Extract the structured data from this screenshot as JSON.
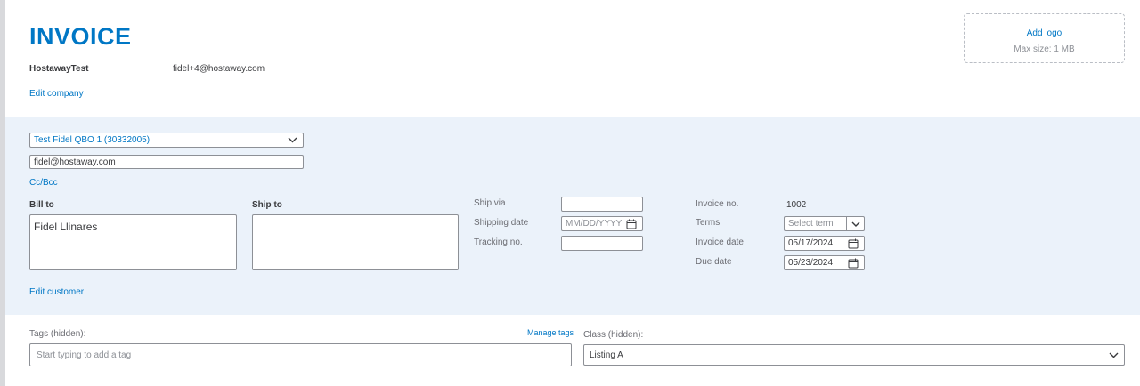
{
  "header": {
    "title": "INVOICE",
    "company_name": "HostawayTest",
    "company_email": "fidel+4@hostaway.com",
    "edit_company": "Edit company",
    "logo": {
      "add_label": "Add logo",
      "max_size": "Max size: 1 MB"
    }
  },
  "customer": {
    "selected": "Test Fidel QBO 1 (30332005)",
    "email": "fidel@hostaway.com",
    "cc_bcc": "Cc/Bcc",
    "bill_to_label": "Bill to",
    "bill_to_value": "Fidel Llinares",
    "ship_to_label": "Ship to",
    "ship_to_value": "",
    "edit_customer": "Edit customer"
  },
  "shipping": {
    "ship_via_label": "Ship via",
    "ship_via_value": "",
    "shipping_date_label": "Shipping date",
    "shipping_date_placeholder": "MM/DD/YYYY",
    "tracking_label": "Tracking no.",
    "tracking_value": ""
  },
  "invoice": {
    "number_label": "Invoice no.",
    "number_value": "1002",
    "terms_label": "Terms",
    "terms_placeholder": "Select term",
    "invoice_date_label": "Invoice date",
    "invoice_date_value": "05/17/2024",
    "due_date_label": "Due date",
    "due_date_value": "05/23/2024"
  },
  "tags": {
    "label": "Tags (hidden):",
    "manage": "Manage tags",
    "placeholder": "Start typing to add a tag"
  },
  "class_field": {
    "label": "Class (hidden):",
    "value": "Listing A"
  },
  "colors": {
    "accent": "#0077c5",
    "band": "#ebf2fa",
    "border": "#8d9096"
  }
}
